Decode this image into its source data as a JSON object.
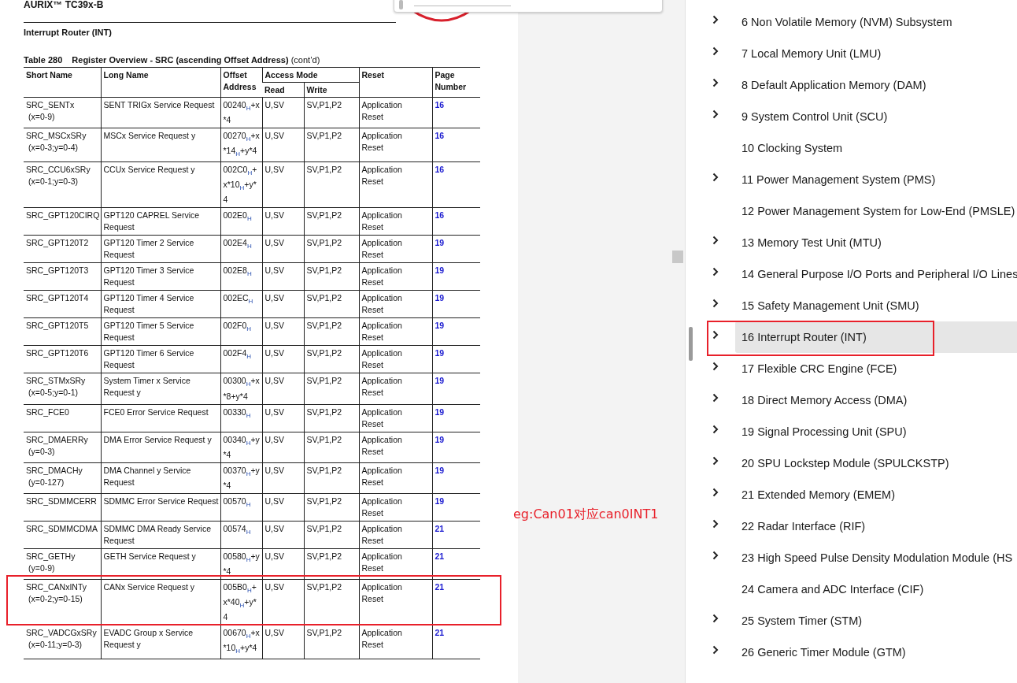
{
  "document": {
    "header": "AURIX™ TC39x-B",
    "section": "Interrupt Router (INT)",
    "table_caption": {
      "number": "Table 280",
      "title": "Register Overview - SRC (ascending Offset Address)",
      "suffix": "(cont’d)"
    }
  },
  "table": {
    "columns": {
      "short_name": "Short Name",
      "long_name": "Long Name",
      "offset": "Offset Address",
      "access": "Access Mode",
      "read": "Read",
      "write": "Write",
      "reset": "Reset",
      "page": "Page Number"
    },
    "rows": [
      {
        "short_name": "SRC_SENTx",
        "range": "(x=0-9)",
        "long_name": "SENT TRIGx Service Request",
        "offset": "00240$_{H}$+x*4",
        "read": "U,SV",
        "write": "SV,P1,P2",
        "reset": "Application Reset",
        "page": "16",
        "highlighted": false
      },
      {
        "short_name": "SRC_MSCxSRy",
        "range": "(x=0-3;y=0-4)",
        "long_name": "MSCx Service Request y",
        "offset": "00270$_{H}$+x*14$_{H}$+y*4",
        "read": "U,SV",
        "write": "SV,P1,P2",
        "reset": "Application Reset",
        "page": "16",
        "highlighted": false
      },
      {
        "short_name": "SRC_CCU6xSRy",
        "range": "(x=0-1;y=0-3)",
        "long_name": "CCUx Service Request y",
        "offset": "002C0$_{H}$+x*10$_{H}$+y*4",
        "read": "U,SV",
        "write": "SV,P1,P2",
        "reset": "Application Reset",
        "page": "16",
        "highlighted": false
      },
      {
        "short_name": "SRC_GPT120CIRQ",
        "long_name": "GPT120 CAPREL Service Request",
        "offset": "002E0$_{H}$",
        "read": "U,SV",
        "write": "SV,P1,P2",
        "reset": "Application Reset",
        "page": "16",
        "highlighted": false
      },
      {
        "short_name": "SRC_GPT120T2",
        "long_name": "GPT120 Timer 2 Service Request",
        "offset": "002E4$_{H}$",
        "read": "U,SV",
        "write": "SV,P1,P2",
        "reset": "Application Reset",
        "page": "19",
        "highlighted": false
      },
      {
        "short_name": "SRC_GPT120T3",
        "long_name": "GPT120 Timer 3 Service Request",
        "offset": "002E8$_{H}$",
        "read": "U,SV",
        "write": "SV,P1,P2",
        "reset": "Application Reset",
        "page": "19",
        "highlighted": false
      },
      {
        "short_name": "SRC_GPT120T4",
        "long_name": "GPT120 Timer 4 Service Request",
        "offset": "002EC$_{H}$",
        "read": "U,SV",
        "write": "SV,P1,P2",
        "reset": "Application Reset",
        "page": "19",
        "highlighted": false
      },
      {
        "short_name": "SRC_GPT120T5",
        "long_name": "GPT120 Timer 5 Service Request",
        "offset": "002F0$_{H}$",
        "read": "U,SV",
        "write": "SV,P1,P2",
        "reset": "Application Reset",
        "page": "19",
        "highlighted": false
      },
      {
        "short_name": "SRC_GPT120T6",
        "long_name": "GPT120 Timer 6 Service Request",
        "offset": "002F4$_{H}$",
        "read": "U,SV",
        "write": "SV,P1,P2",
        "reset": "Application Reset",
        "page": "19",
        "highlighted": false
      },
      {
        "short_name": "SRC_STMxSRy",
        "range": "(x=0-5;y=0-1)",
        "long_name": "System Timer x Service Request y",
        "offset": "00300$_{H}$+x*8+y*4",
        "read": "U,SV",
        "write": "SV,P1,P2",
        "reset": "Application Reset",
        "page": "19",
        "highlighted": false
      },
      {
        "short_name": "SRC_FCE0",
        "long_name": "FCE0 Error Service Request",
        "offset": "00330$_{H}$",
        "read": "U,SV",
        "write": "SV,P1,P2",
        "reset": "Application Reset",
        "page": "19",
        "highlighted": false
      },
      {
        "short_name": "SRC_DMAERRy",
        "range": "(y=0-3)",
        "long_name": "DMA Error Service Request y",
        "offset": "00340$_{H}$+y*4",
        "read": "U,SV",
        "write": "SV,P1,P2",
        "reset": "Application Reset",
        "page": "19",
        "highlighted": false
      },
      {
        "short_name": "SRC_DMACHy",
        "range": "(y=0-127)",
        "long_name": "DMA Channel  y Service Request",
        "offset": "00370$_{H}$+y*4",
        "read": "U,SV",
        "write": "SV,P1,P2",
        "reset": "Application Reset",
        "page": "19",
        "highlighted": false
      },
      {
        "short_name": "SRC_SDMMCERR",
        "long_name": "SDMMC Error Service Request",
        "offset": "00570$_{H}$",
        "read": "U,SV",
        "write": "SV,P1,P2",
        "reset": "Application Reset",
        "page": "19",
        "highlighted": false
      },
      {
        "short_name": "SRC_SDMMCDMA",
        "long_name": "SDMMC DMA Ready Service Request",
        "offset": "00574$_{H}$",
        "read": "U,SV",
        "write": "SV,P1,P2",
        "reset": "Application Reset",
        "page": "21",
        "highlighted": false
      },
      {
        "short_name": "SRC_GETHy",
        "range": "(y=0-9)",
        "long_name": "GETH Service Request y",
        "offset": "00580$_{H}$+y*4",
        "read": "U,SV",
        "write": "SV,P1,P2",
        "reset": "Application Reset",
        "page": "21",
        "highlighted": false
      },
      {
        "short_name": "SRC_CANxINTy",
        "range": "(x=0-2;y=0-15)",
        "long_name": "CANx Service Request y",
        "offset": "005B0$_{H}$+x*40$_{H}$+y*4",
        "read": "U,SV",
        "write": "SV,P1,P2",
        "reset": "Application Reset",
        "page": "21",
        "highlighted": true
      },
      {
        "short_name": "SRC_VADCGxSRy",
        "range": "(x=0-11;y=0-3)",
        "long_name": "EVADC Group x Service Request y",
        "offset": "00670$_{H}$+x*10$_{H}$+y*4",
        "read": "U,SV",
        "write": "SV,P1,P2",
        "reset": "Application Reset",
        "page": "21",
        "highlighted": false
      }
    ]
  },
  "annotation": "eg:Can01对应can0INT1",
  "toc": {
    "items": [
      {
        "label": "6 Non Volatile Memory (NVM) Subsystem",
        "expandable": true,
        "selected": false,
        "highlighted": false
      },
      {
        "label": "7 Local Memory Unit (LMU)",
        "expandable": true,
        "selected": false,
        "highlighted": false
      },
      {
        "label": "8 Default Application Memory (DAM)",
        "expandable": true,
        "selected": false,
        "highlighted": false
      },
      {
        "label": "9 System Control Unit (SCU)",
        "expandable": true,
        "selected": false,
        "highlighted": false
      },
      {
        "label": "10 Clocking System",
        "expandable": false,
        "selected": false,
        "highlighted": false
      },
      {
        "label": "11 Power Management System (PMS)",
        "expandable": true,
        "selected": false,
        "highlighted": false
      },
      {
        "label": "12 Power Management System for Low-End (PMSLE)",
        "expandable": false,
        "selected": false,
        "highlighted": false
      },
      {
        "label": "13 Memory Test Unit (MTU)",
        "expandable": true,
        "selected": false,
        "highlighted": false
      },
      {
        "label": "14 General Purpose I/O Ports and Peripheral I/O Lines",
        "expandable": true,
        "selected": false,
        "highlighted": false
      },
      {
        "label": "15 Safety Management Unit (SMU)",
        "expandable": true,
        "selected": false,
        "highlighted": false
      },
      {
        "label": "16 Interrupt Router (INT)",
        "expandable": true,
        "selected": true,
        "highlighted": true
      },
      {
        "label": "17 Flexible CRC Engine (FCE)",
        "expandable": true,
        "selected": false,
        "highlighted": false
      },
      {
        "label": "18 Direct Memory Access (DMA)",
        "expandable": true,
        "selected": false,
        "highlighted": false
      },
      {
        "label": "19 Signal Processing Unit (SPU)",
        "expandable": true,
        "selected": false,
        "highlighted": false
      },
      {
        "label": "20 SPU Lockstep Module (SPULCKSTP)",
        "expandable": true,
        "selected": false,
        "highlighted": false
      },
      {
        "label": "21 Extended Memory (EMEM)",
        "expandable": true,
        "selected": false,
        "highlighted": false
      },
      {
        "label": "22 Radar Interface (RIF)",
        "expandable": true,
        "selected": false,
        "highlighted": false
      },
      {
        "label": "23 High Speed Pulse Density Modulation Module (HS",
        "expandable": true,
        "selected": false,
        "highlighted": false
      },
      {
        "label": "24 Camera and ADC Interface (CIF)",
        "expandable": false,
        "selected": false,
        "highlighted": false
      },
      {
        "label": "25 System Timer (STM)",
        "expandable": true,
        "selected": false,
        "highlighted": false
      },
      {
        "label": "26 Generic Timer Module (GTM)",
        "expandable": true,
        "selected": false,
        "highlighted": false
      }
    ]
  }
}
